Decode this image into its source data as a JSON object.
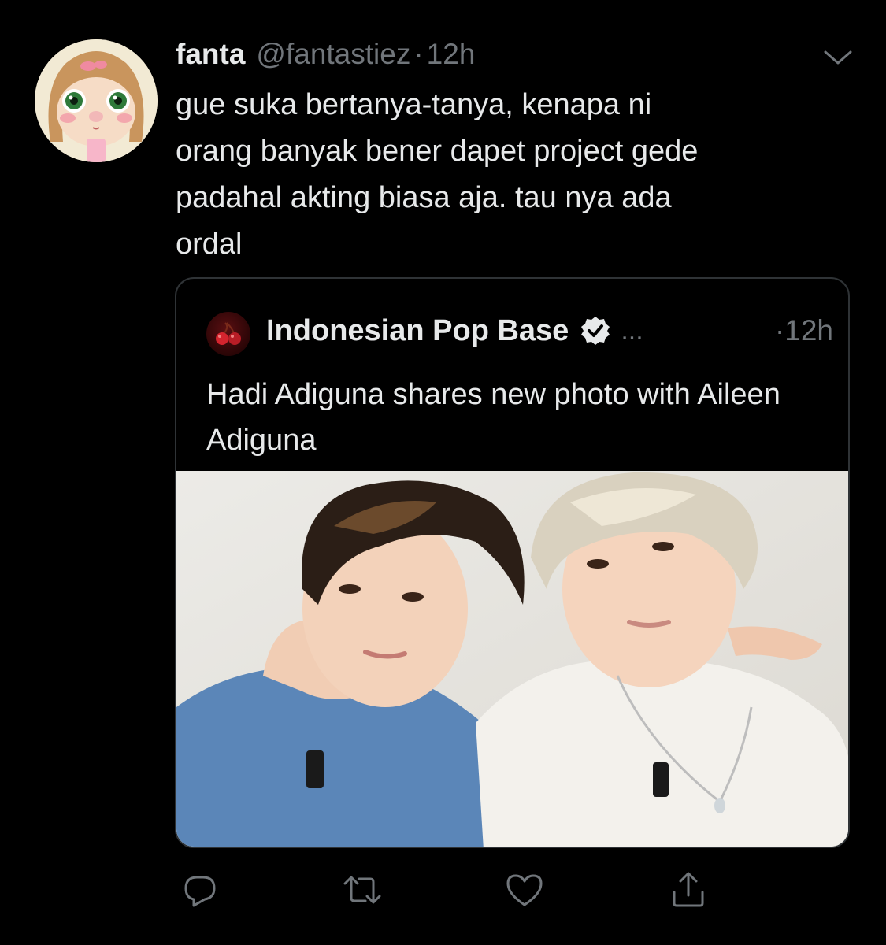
{
  "tweet": {
    "display_name": "fanta",
    "handle": "@fantastiez",
    "separator": "·",
    "time": "12h",
    "text": "gue suka bertanya-tanya, kenapa ni\norang banyak bener dapet project gede\npadahal akting biasa aja. tau nya ada\nordal"
  },
  "quoted": {
    "display_name": "Indonesian Pop Base",
    "ellipsis": "...",
    "time": "·12h",
    "text": "Hadi Adiguna shares new photo with Aileen Adiguna"
  },
  "actions": [
    {
      "name": "reply",
      "icon": "reply-icon"
    },
    {
      "name": "retweet",
      "icon": "retweet-icon"
    },
    {
      "name": "like",
      "icon": "heart-icon"
    },
    {
      "name": "share",
      "icon": "share-icon"
    }
  ],
  "colors": {
    "background": "#000000",
    "text": "#e7e9ea",
    "muted": "#71767b",
    "border": "#2f3336"
  }
}
